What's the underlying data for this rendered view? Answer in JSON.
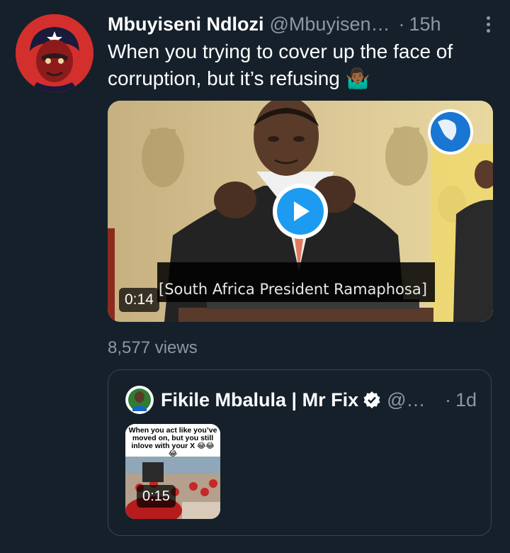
{
  "tweet": {
    "name": "Mbuyiseni Ndlozi",
    "handle": "@Mbuyisen…",
    "separator": "·",
    "time": "15h",
    "text": "When you trying to cover up the face of corruption, but it’s refusing 🤷🏾‍♂️",
    "video": {
      "duration": "0:14",
      "subtitle": "[South Africa President Ramaphosa]"
    },
    "views": "8,577 views"
  },
  "quote": {
    "name": "Fikile Mbalula | Mr Fix",
    "handle": "@…",
    "separator": "·",
    "time": "1d",
    "thumb_caption": "When you act like you’ve moved on, but you still inlove with your X 😂😂😂",
    "duration": "0:15"
  },
  "colors": {
    "background": "#15202b",
    "secondary_text": "#8b98a5",
    "accent": "#1d9bf0",
    "border": "#38444d"
  },
  "icons": {
    "more": "more-vertical-icon",
    "play": "play-icon",
    "verified": "verified-badge-icon"
  }
}
